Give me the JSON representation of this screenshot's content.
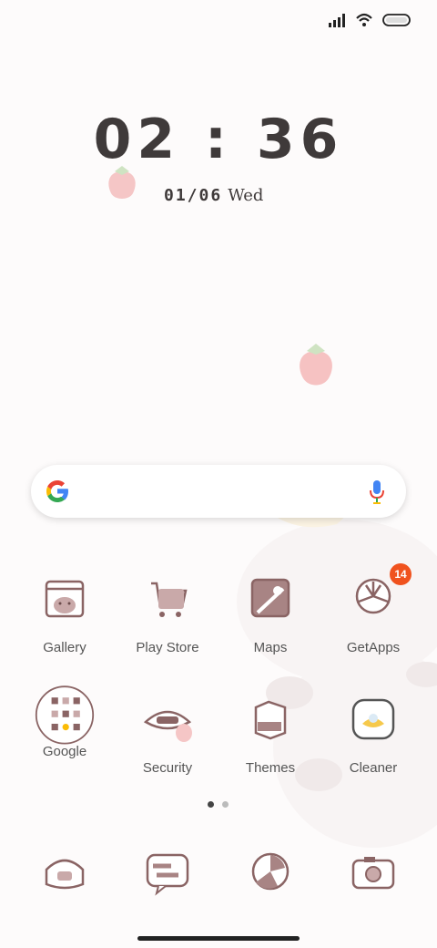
{
  "status_bar": {
    "icons": [
      "signal-icon",
      "wifi-icon",
      "battery-icon"
    ]
  },
  "clock": {
    "time": "02 : 36",
    "date": "01/06",
    "weekday": "Wed"
  },
  "search": {
    "icons": [
      "google-logo-icon",
      "microphone-icon"
    ]
  },
  "apps": [
    {
      "label": "Gallery",
      "icon": "gallery-icon"
    },
    {
      "label": "Play Store",
      "icon": "play-store-icon"
    },
    {
      "label": "Maps",
      "icon": "maps-icon"
    },
    {
      "label": "GetApps",
      "icon": "getapps-icon",
      "badge": "14"
    },
    {
      "label": "Google",
      "icon": "google-folder-icon"
    },
    {
      "label": "Security",
      "icon": "security-icon"
    },
    {
      "label": "Themes",
      "icon": "themes-icon"
    },
    {
      "label": "Cleaner",
      "icon": "cleaner-icon"
    }
  ],
  "page_indicator": {
    "pages": 2,
    "current": 1
  },
  "dock": [
    {
      "icon": "phone-icon"
    },
    {
      "icon": "messages-icon"
    },
    {
      "icon": "browser-icon"
    },
    {
      "icon": "camera-icon"
    }
  ],
  "colors": {
    "icon_stroke": "#8a6464",
    "icon_fill": "#c9a9a9",
    "badge": "#f0521e",
    "text": "#555555"
  }
}
